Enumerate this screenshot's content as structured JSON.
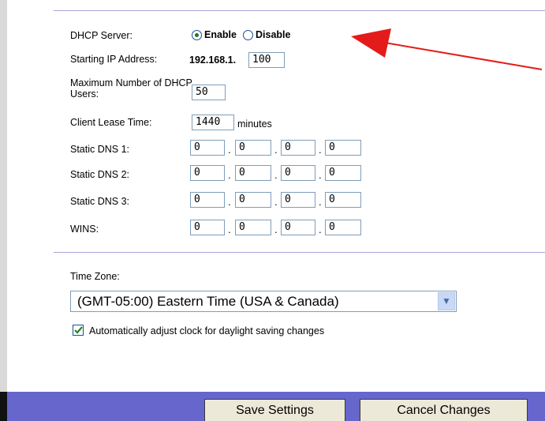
{
  "dhcp": {
    "server_label": "DHCP Server:",
    "enable_label": "Enable",
    "disable_label": "Disable",
    "selected": "Enable",
    "start_ip_label": "Starting IP Address:",
    "start_ip_prefix": "192.168.1.",
    "start_ip_last": "100",
    "max_users_label": "Maximum Number of DHCP Users:",
    "max_users": "50",
    "lease_label": "Client Lease Time:",
    "lease_value": "1440",
    "lease_unit": "minutes"
  },
  "dns": [
    {
      "label": "Static DNS 1:",
      "octets": [
        "0",
        "0",
        "0",
        "0"
      ]
    },
    {
      "label": "Static DNS 2:",
      "octets": [
        "0",
        "0",
        "0",
        "0"
      ]
    },
    {
      "label": "Static DNS 3:",
      "octets": [
        "0",
        "0",
        "0",
        "0"
      ]
    },
    {
      "label": "WINS:",
      "octets": [
        "0",
        "0",
        "0",
        "0"
      ]
    }
  ],
  "ip_separator": ".",
  "timezone": {
    "label": "Time Zone:",
    "value": "(GMT-05:00) Eastern Time (USA & Canada)",
    "dst_label": "Automatically adjust clock for daylight saving changes",
    "dst_checked": true
  },
  "buttons": {
    "save": "Save Settings",
    "cancel": "Cancel Changes"
  },
  "colors": {
    "footer": "#6666cc",
    "arrow": "#e41b1b"
  }
}
